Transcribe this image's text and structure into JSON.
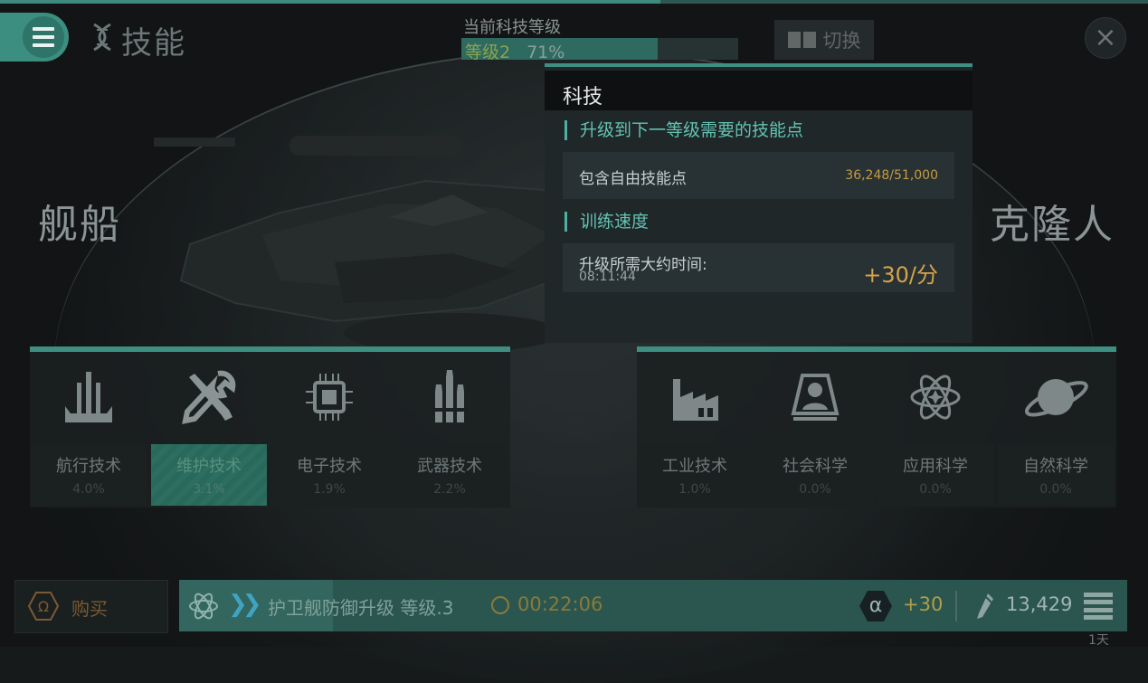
{
  "header": {
    "title": "技能",
    "level_label": "当前科技等级",
    "level_value": "等级2",
    "level_percent": "71%",
    "level_progress": 0.71,
    "switch_label": "切换"
  },
  "sides": {
    "left": "舰船",
    "right": "克隆人"
  },
  "categories_left": [
    {
      "name": "航行技术",
      "percent": "4.0%",
      "icon": "ship-thrusters-icon"
    },
    {
      "name": "维护技术",
      "percent": "3.1%",
      "icon": "wrench-screwdriver-icon",
      "selected": true
    },
    {
      "name": "电子技术",
      "percent": "1.9%",
      "icon": "chip-icon"
    },
    {
      "name": "武器技术",
      "percent": "2.2%",
      "icon": "missiles-icon"
    }
  ],
  "categories_right": [
    {
      "name": "工业技术",
      "percent": "1.0%",
      "icon": "factory-icon"
    },
    {
      "name": "社会科学",
      "percent": "0.0%",
      "icon": "person-portrait-icon"
    },
    {
      "name": "应用科学",
      "percent": "0.0%",
      "icon": "atom-star-icon"
    },
    {
      "name": "自然科学",
      "percent": "0.0%",
      "icon": "planet-ring-icon"
    }
  ],
  "tooltip": {
    "title": "科技",
    "section1": "升级到下一等级需要的技能点",
    "free_points_label": "包含自由技能点",
    "free_points_value": "36,248/51,000",
    "section2": "训练速度",
    "time_label": "升级所需大约时间:",
    "time_value": "08:11:44",
    "rate": "+30/分"
  },
  "bottom": {
    "buy_label": "购买",
    "queue_text": "护卫舰防御升级 等级.3",
    "timer": "00:22:06",
    "alpha_symbol": "α",
    "alpha_bonus": "+30",
    "points": "13,429",
    "days": "1天"
  },
  "colors": {
    "accent": "#3f8f81",
    "gold": "#d7a24a",
    "teal_text": "#63c2b3"
  }
}
